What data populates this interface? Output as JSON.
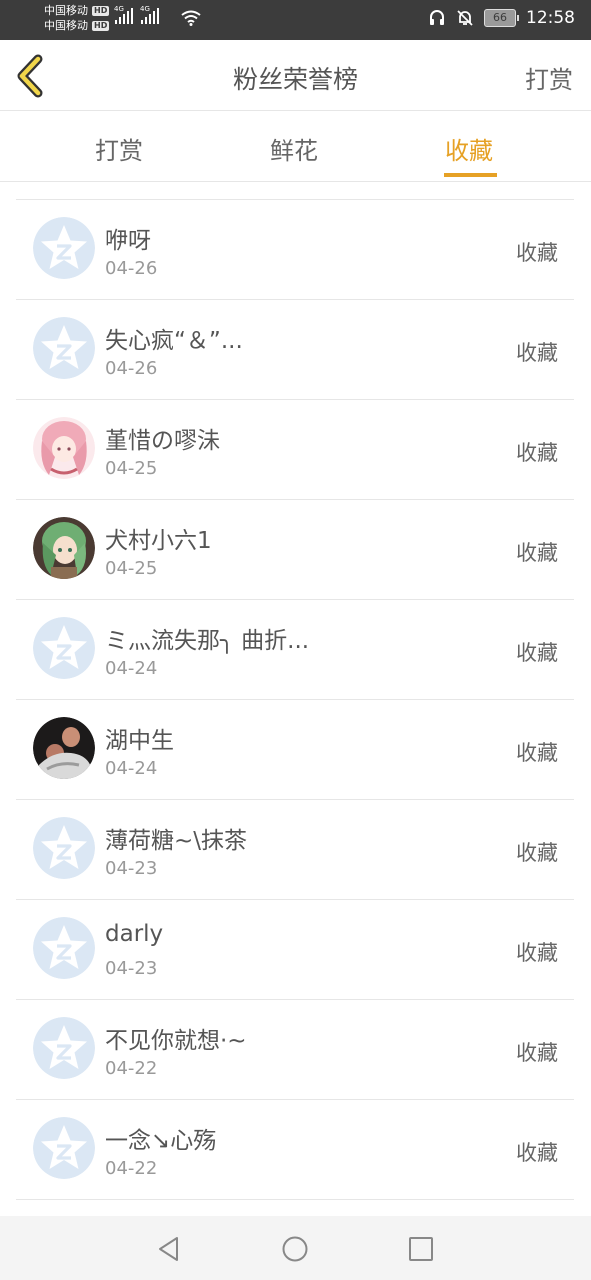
{
  "status_bar": {
    "carrier1": "中国移动",
    "carrier2": "中国移动",
    "hd": "HD",
    "net_type": "4G",
    "battery": "66",
    "time": "12:58"
  },
  "header": {
    "title": "粉丝荣誉榜",
    "action": "打赏"
  },
  "tabs": [
    {
      "label": "打赏"
    },
    {
      "label": "鲜花"
    },
    {
      "label": "收藏"
    }
  ],
  "list": [
    {
      "name": "咿呀",
      "date": "04-26",
      "tag": "收藏",
      "avatar": "default-star"
    },
    {
      "name": "失心疯“＆”...",
      "date": "04-26",
      "tag": "收藏",
      "avatar": "default-star"
    },
    {
      "name": "堇惜の嘐沬",
      "date": "04-25",
      "tag": "收藏",
      "avatar": "anime-pink-hair"
    },
    {
      "name": "犬村小六1",
      "date": "04-25",
      "tag": "收藏",
      "avatar": "anime-green-hair"
    },
    {
      "name": "ミ灬流失那╮ 曲折...",
      "date": "04-24",
      "tag": "收藏",
      "avatar": "default-star"
    },
    {
      "name": "湖中生",
      "date": "04-24",
      "tag": "收藏",
      "avatar": "photo-person"
    },
    {
      "name": "薄荷糖~\\抹茶",
      "date": "04-23",
      "tag": "收藏",
      "avatar": "default-star"
    },
    {
      "name": "darly",
      "date": "04-23",
      "tag": "收藏",
      "avatar": "default-star"
    },
    {
      "name": "不见你就想·~",
      "date": "04-22",
      "tag": "收藏",
      "avatar": "default-star"
    },
    {
      "name": "一念↘心殇",
      "date": "04-22",
      "tag": "收藏",
      "avatar": "default-star"
    }
  ],
  "colors": {
    "accent": "#e6a125",
    "status_bar": "#3c3c3c",
    "divider": "#e6e6e6"
  }
}
